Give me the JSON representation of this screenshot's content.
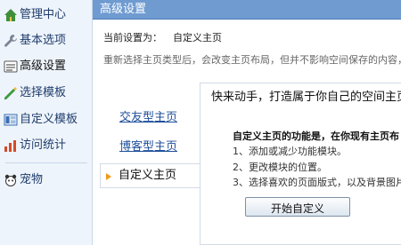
{
  "sidebar": {
    "items": [
      {
        "label": "管理中心",
        "icon": "home-icon"
      },
      {
        "label": "基本选项",
        "icon": "wrench-icon"
      },
      {
        "label": "高级设置",
        "icon": "settings-icon"
      },
      {
        "label": "选择模板",
        "icon": "pencil-icon"
      },
      {
        "label": "自定义模板",
        "icon": "template-icon"
      },
      {
        "label": "访问统计",
        "icon": "stats-icon"
      },
      {
        "label": "宠物",
        "icon": "pet-icon"
      }
    ]
  },
  "panel": {
    "title": "高级设置",
    "current_label": "当前设置为：",
    "current_value": "自定义主页",
    "note": "重新选择主页类型后，会改变主页布局，但并不影响空间保存的内容，以"
  },
  "tabs": [
    {
      "label": "交友型主页"
    },
    {
      "label": "博客型主页"
    },
    {
      "label": "自定义主页"
    }
  ],
  "content": {
    "banner": "快来动手，打造属于你自己的空间主页",
    "feature_title": "自定义主页的功能是，在你现有主页布",
    "features": [
      "1、添加或减少功能模块。",
      "2、更改模块的位置。",
      "3、选择喜欢的页面版式，以及背景图片。"
    ],
    "start_button": "开始自定义"
  },
  "colors": {
    "titlebar": "#6f9bd1",
    "sidebar_bg": "#eef4fb",
    "link": "#1f4f9a",
    "tab_arrow": "#f09a1b"
  }
}
